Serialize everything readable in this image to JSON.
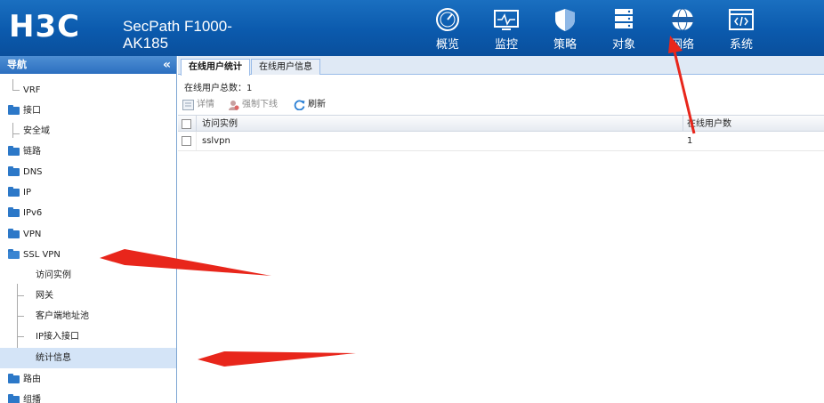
{
  "header": {
    "logo": "H3C",
    "model_line1": "SecPath F1000-",
    "model_line2": "AK185",
    "nav": [
      {
        "label": "概览",
        "icon": "gauge-icon"
      },
      {
        "label": "监控",
        "icon": "monitor-icon"
      },
      {
        "label": "策略",
        "icon": "shield-icon"
      },
      {
        "label": "对象",
        "icon": "server-icon"
      },
      {
        "label": "网络",
        "icon": "globe-icon"
      },
      {
        "label": "系统",
        "icon": "code-window-icon"
      }
    ]
  },
  "sidebar": {
    "title": "导航",
    "collapse": "«",
    "items": [
      {
        "label": "VRF",
        "type": "leaf"
      },
      {
        "label": "接口",
        "type": "folder"
      },
      {
        "label": "安全域",
        "type": "leaf"
      },
      {
        "label": "链路",
        "type": "folder"
      },
      {
        "label": "DNS",
        "type": "folder"
      },
      {
        "label": "IP",
        "type": "folder"
      },
      {
        "label": "IPv6",
        "type": "folder"
      },
      {
        "label": "VPN",
        "type": "folder"
      },
      {
        "label": "SSL VPN",
        "type": "folder-open"
      },
      {
        "label": "访问实例",
        "type": "child"
      },
      {
        "label": "网关",
        "type": "child"
      },
      {
        "label": "客户端地址池",
        "type": "child"
      },
      {
        "label": "IP接入接口",
        "type": "child"
      },
      {
        "label": "统计信息",
        "type": "child-selected"
      },
      {
        "label": "路由",
        "type": "folder"
      },
      {
        "label": "组播",
        "type": "folder"
      }
    ]
  },
  "tabs": [
    {
      "label": "在线用户统计",
      "active": true
    },
    {
      "label": "在线用户信息",
      "active": false
    }
  ],
  "summary": "在线用户总数：1",
  "toolbar": {
    "details": "详情",
    "force_offline": "强制下线",
    "refresh": "刷新"
  },
  "table": {
    "columns": [
      "访问实例",
      "在线用户数"
    ],
    "rows": [
      {
        "instance": "sslvpn",
        "count": "1"
      }
    ]
  },
  "colors": {
    "header_blue": "#0b5aad",
    "annotation_red": "#e8261b"
  }
}
